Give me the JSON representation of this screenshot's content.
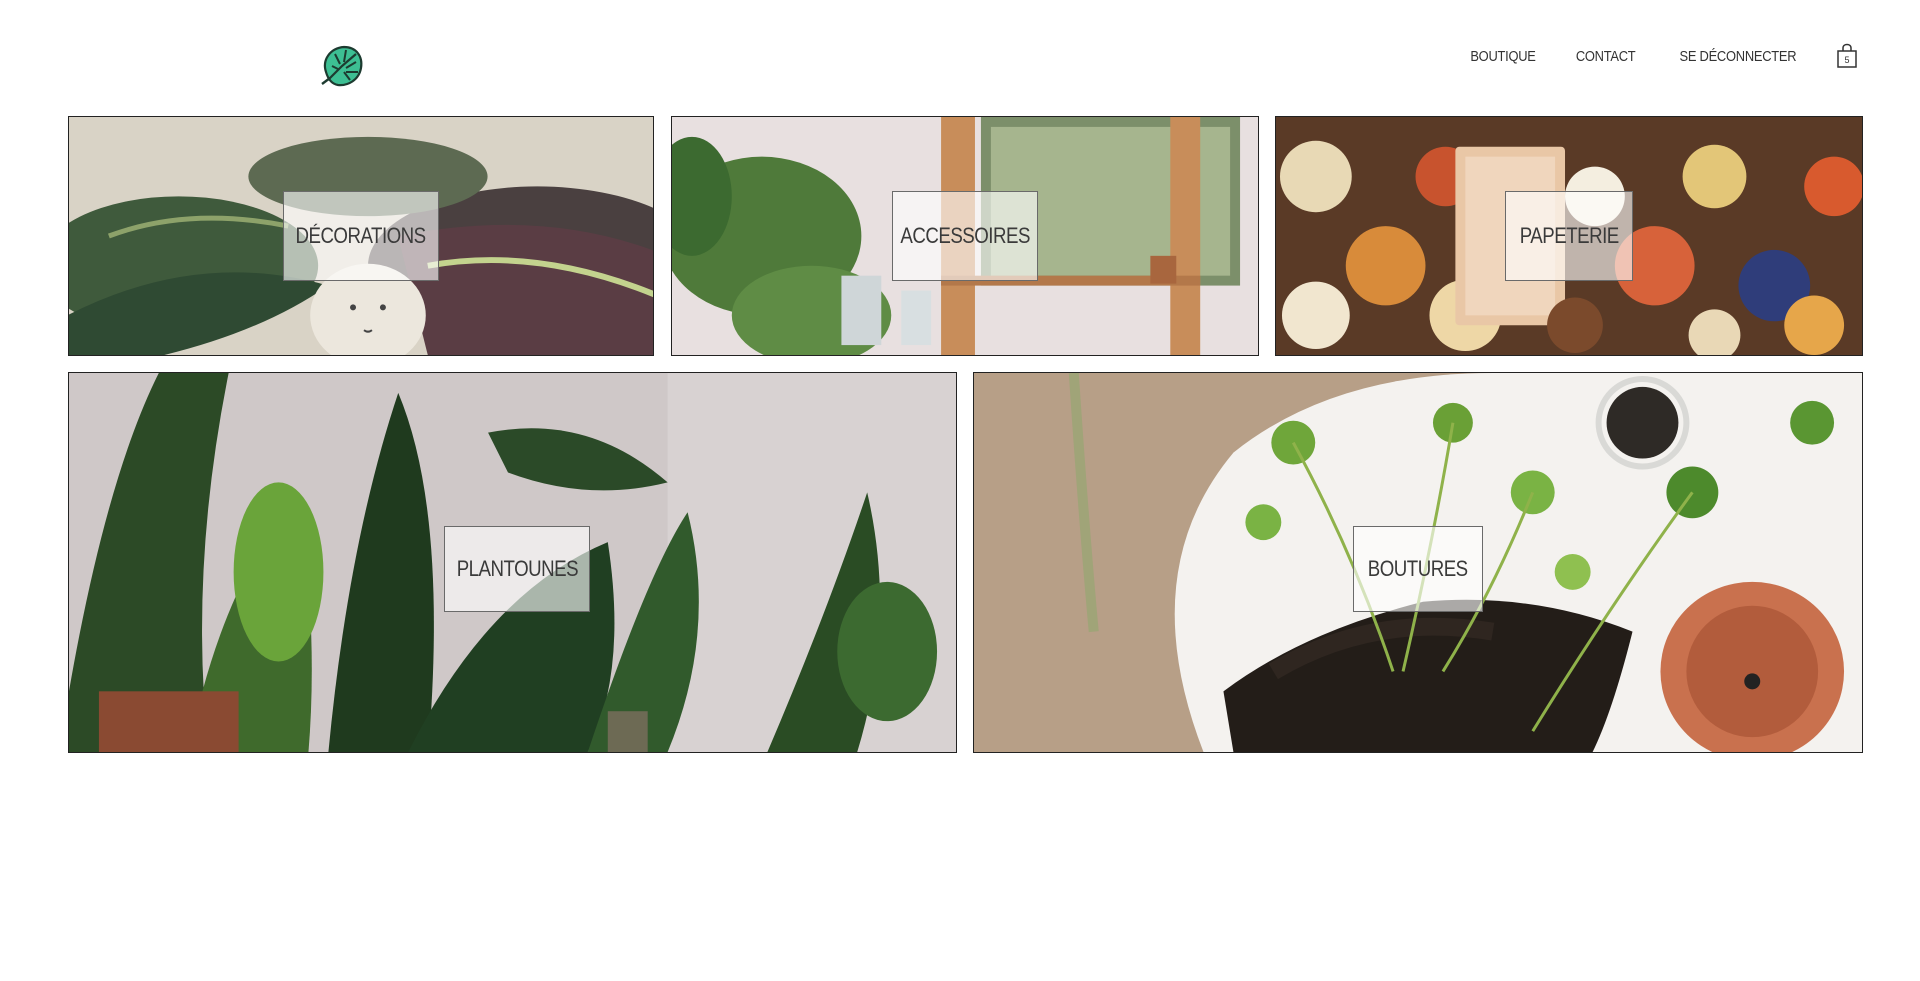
{
  "header": {
    "logo_icon": "monstera-leaf-icon",
    "logo_color": "#2fb58a",
    "nav": [
      {
        "label": "BOUTIQUE"
      },
      {
        "label": "CONTACT"
      },
      {
        "label": "SE DÉCONNECTER"
      }
    ],
    "cart_icon": "shopping-bag-icon",
    "cart_count": "5"
  },
  "categories": {
    "top": [
      {
        "label": "DÉCORATIONS",
        "image": "calathea plant leaves with ceramic face pot"
      },
      {
        "label": "ACCESSOIRES",
        "image": "shelf with plants, glass jars and window"
      },
      {
        "label": "PAPETERIE",
        "image": "autumn leaf and mushroom stickers on wood"
      }
    ],
    "bottom": [
      {
        "label": "PLANTOUNES",
        "image": "indoor tropical plants against pale wall"
      },
      {
        "label": "BOUTURES",
        "image": "pilea cuttings with soil and terracotta pot"
      }
    ]
  }
}
